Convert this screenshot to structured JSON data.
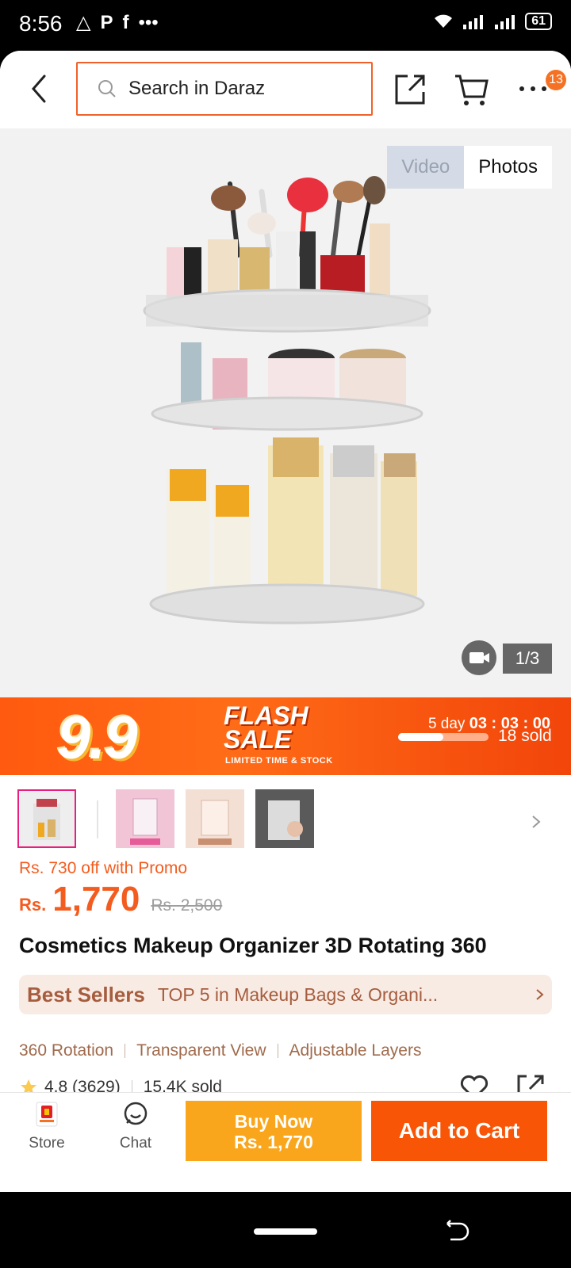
{
  "status_bar": {
    "time": "8:56",
    "left_glyphs": [
      "△",
      "P",
      "f",
      "•••"
    ],
    "battery": "61"
  },
  "header": {
    "search_placeholder": "Search in Daraz",
    "cart_badge": "13"
  },
  "gallery": {
    "toggle_video": "Video",
    "toggle_photos": "Photos",
    "counter": "1/3"
  },
  "flash": {
    "campaign": "9.9",
    "title_line1": "FLASH",
    "title_line2": "SALE",
    "subtitle": "LIMITED TIME & STOCK",
    "days": "5 day",
    "time": "03 : 03 : 00",
    "sold": "18 sold",
    "sold_progress": 0.5
  },
  "product": {
    "promo": "Rs. 730 off with Promo",
    "currency": "Rs.",
    "price": "1,770",
    "old_price": "Rs. 2,500",
    "title": "Cosmetics Makeup Organizer 3D Rotating 360",
    "best_sellers_logo": "Best Sellers",
    "best_sellers_text": "TOP 5 in Makeup Bags & Organi...",
    "features": [
      "360 Rotation",
      "Transparent View",
      "Adjustable Layers"
    ],
    "rating": "4.8 (3629)",
    "sold": "15.4K sold"
  },
  "bottom_bar": {
    "store": "Store",
    "chat": "Chat",
    "buy_now_line1": "Buy Now",
    "buy_now_line2": "Rs. 1,770",
    "add_to_cart": "Add to Cart"
  },
  "colors": {
    "accent": "#f85606",
    "buy_now": "#faa61c",
    "price": "#f45b1e",
    "bestseller_bg": "#f8ebe3"
  }
}
